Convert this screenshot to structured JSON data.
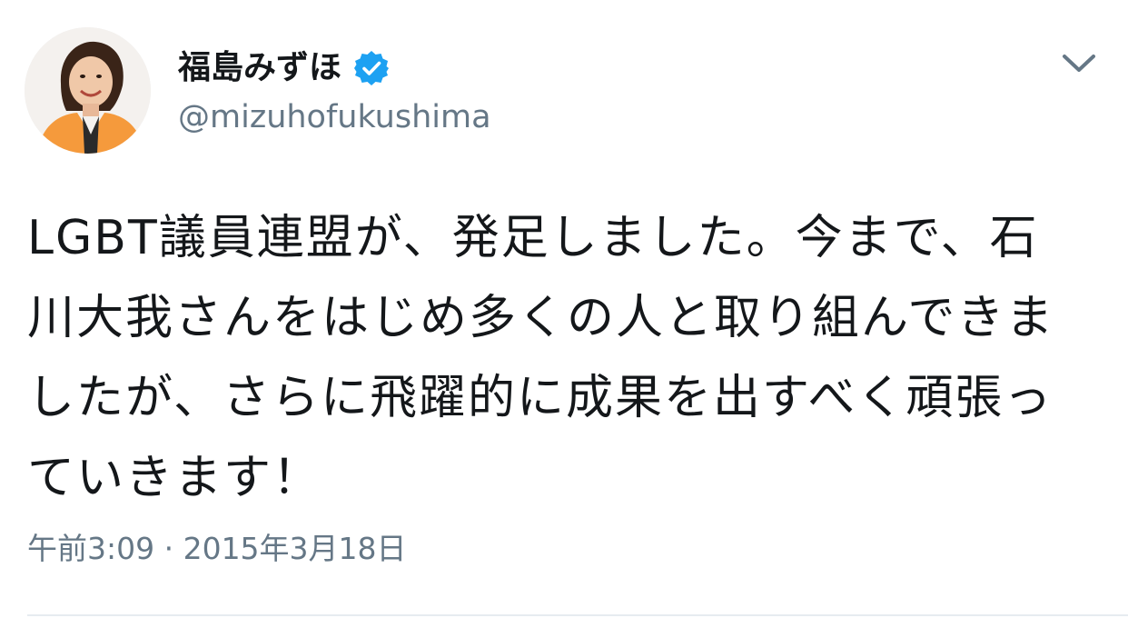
{
  "tweet": {
    "author": {
      "display_name": "福島みずほ",
      "handle": "@mizuhofukushima",
      "verified": true,
      "avatar_icon": "profile-photo"
    },
    "text": "LGBT議員連盟が、発足しました。今まで、石川大我さんをはじめ多くの人と取り組んできましたが、さらに飛躍的に成果を出すべく頑張っていきます！",
    "timestamp": "午前3:09 · 2015年3月18日",
    "menu_icon": "chevron-down-icon",
    "colors": {
      "verified_badge": "#1da1f2",
      "secondary_text": "#657786",
      "primary_text": "#14171a"
    }
  }
}
